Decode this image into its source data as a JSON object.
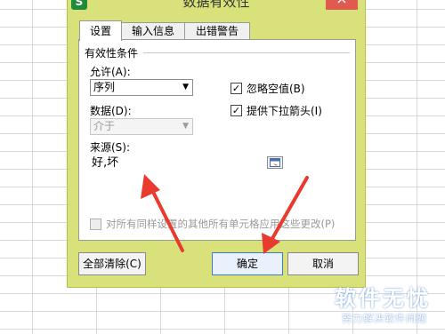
{
  "dialog": {
    "title": "数据有效性",
    "close_label": "×",
    "app_icon": "S",
    "tabs": [
      {
        "label": "设置",
        "active": true
      },
      {
        "label": "输入信息",
        "active": false
      },
      {
        "label": "出错警告",
        "active": false
      }
    ]
  },
  "settings": {
    "group_title": "有效性条件",
    "allow_label": "允许(A):",
    "allow_value": "序列",
    "data_label": "数据(D):",
    "data_value": "介于",
    "ignore_blank_label": "忽略空值(B)",
    "ignore_blank_checked": true,
    "dropdown_label": "提供下拉箭头(I)",
    "dropdown_checked": true,
    "source_label": "来源(S):",
    "source_value": "好,坏",
    "apply_all_label": "对所有同样设置的其他所有单元格应用这些更改(P)",
    "apply_all_checked": false
  },
  "buttons": {
    "clear_all": "全部清除(C)",
    "ok": "确定",
    "cancel": "取消"
  },
  "watermark": {
    "title": "软件无忧",
    "subtitle": "努力解决软件问题"
  },
  "colors": {
    "dialog_bg": "#d9e27a",
    "arrow": "#e83a2e",
    "close": "#e05a4f"
  }
}
